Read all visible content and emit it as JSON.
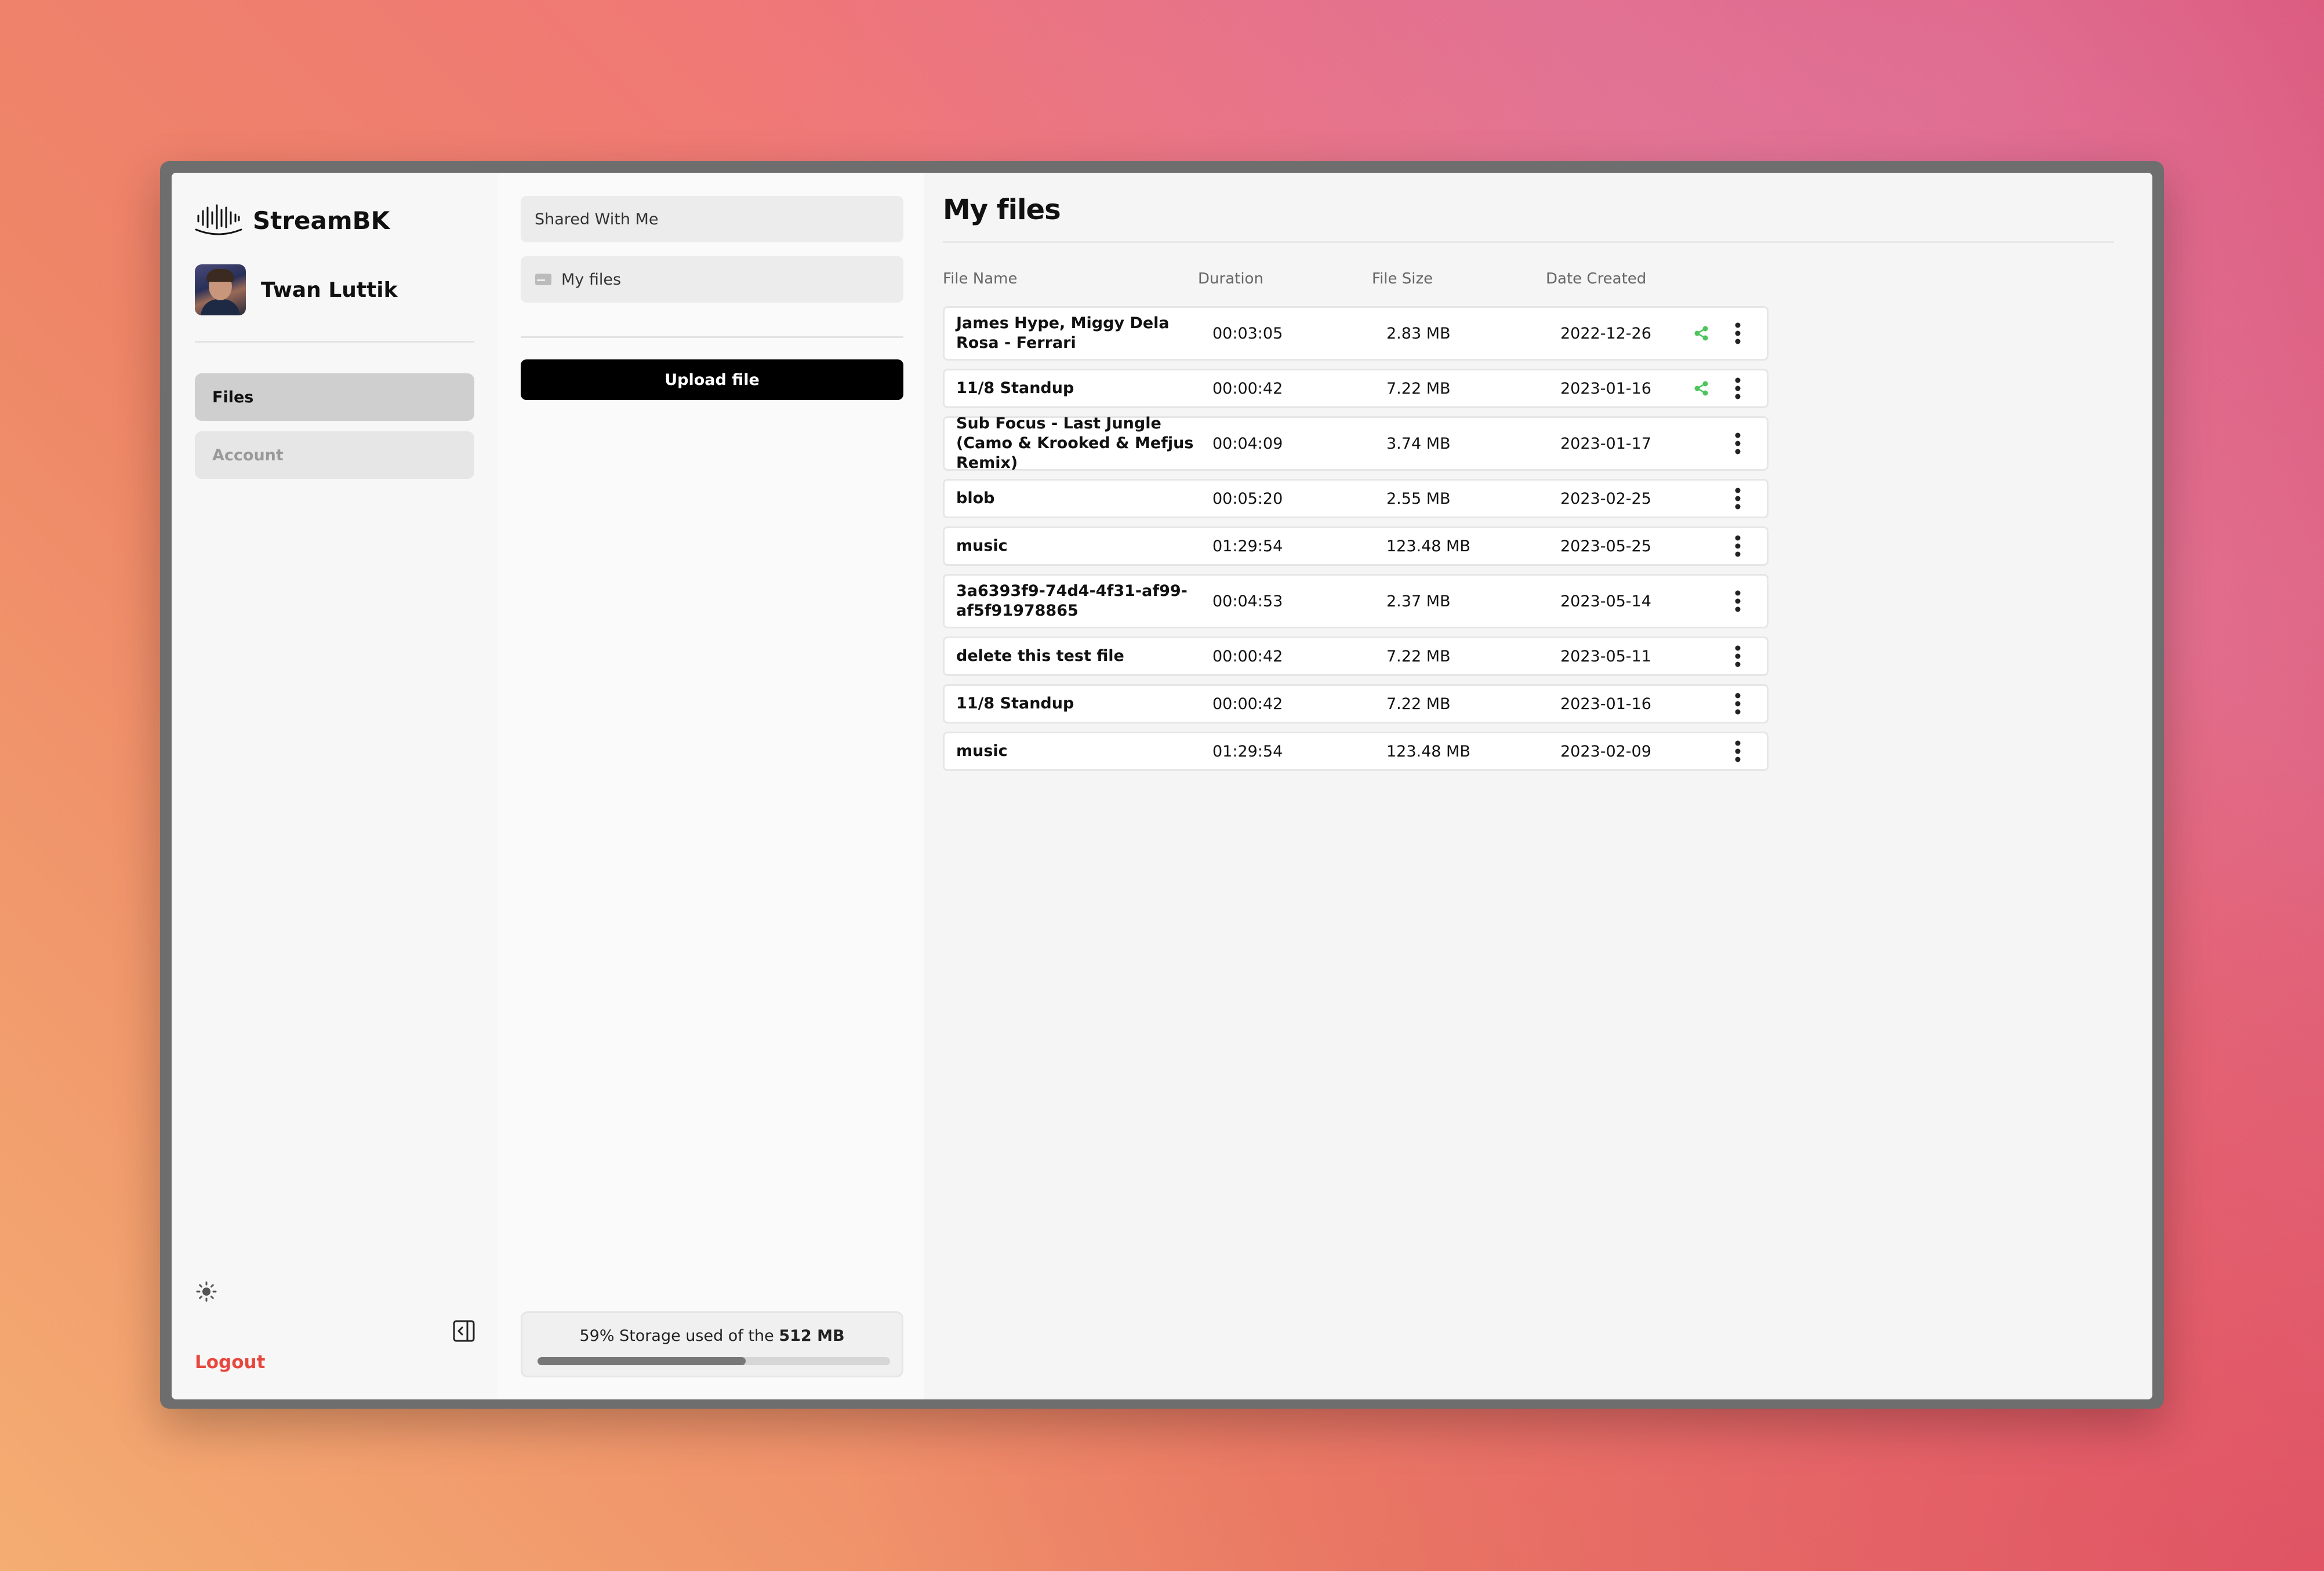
{
  "app": {
    "name": "StreamBK"
  },
  "user": {
    "name": "Twan Luttik"
  },
  "sidebar": {
    "items": [
      {
        "label": "Files",
        "active": true
      },
      {
        "label": "Account",
        "active": false
      }
    ],
    "logout_label": "Logout"
  },
  "folders": {
    "shared": "Shared With Me",
    "mine": "My files"
  },
  "upload_label": "Upload file",
  "storage": {
    "text_prefix": "59% Storage used of the",
    "total": "512 MB",
    "percent": 59
  },
  "main": {
    "title": "My files",
    "columns": {
      "name": "File Name",
      "duration": "Duration",
      "size": "File Size",
      "date": "Date Created"
    },
    "rows": [
      {
        "name": "James Hype, Miggy Dela Rosa - Ferrari",
        "duration": "00:03:05",
        "size": "2.83 MB",
        "date": "2022-12-26",
        "shared": true,
        "tall": true
      },
      {
        "name": "11/8 Standup",
        "duration": "00:00:42",
        "size": "7.22 MB",
        "date": "2023-01-16",
        "shared": true,
        "tall": false
      },
      {
        "name": "Sub Focus - Last Jungle (Camo & Krooked & Mefjus Remix)",
        "duration": "00:04:09",
        "size": "3.74 MB",
        "date": "2023-01-17",
        "shared": false,
        "tall": true
      },
      {
        "name": "blob",
        "duration": "00:05:20",
        "size": "2.55 MB",
        "date": "2023-02-25",
        "shared": false,
        "tall": false
      },
      {
        "name": "music",
        "duration": "01:29:54",
        "size": "123.48 MB",
        "date": "2023-05-25",
        "shared": false,
        "tall": false
      },
      {
        "name": "3a6393f9-74d4-4f31-af99-af5f91978865",
        "duration": "00:04:53",
        "size": "2.37 MB",
        "date": "2023-05-14",
        "shared": false,
        "tall": true
      },
      {
        "name": "delete this test file",
        "duration": "00:00:42",
        "size": "7.22 MB",
        "date": "2023-05-11",
        "shared": false,
        "tall": false
      },
      {
        "name": "11/8 Standup",
        "duration": "00:00:42",
        "size": "7.22 MB",
        "date": "2023-01-16",
        "shared": false,
        "tall": false
      },
      {
        "name": "music",
        "duration": "01:29:54",
        "size": "123.48 MB",
        "date": "2023-02-09",
        "shared": false,
        "tall": false
      }
    ]
  },
  "colors": {
    "share": "#4cc45c",
    "logout": "#e8473d",
    "accent": "#000000"
  }
}
